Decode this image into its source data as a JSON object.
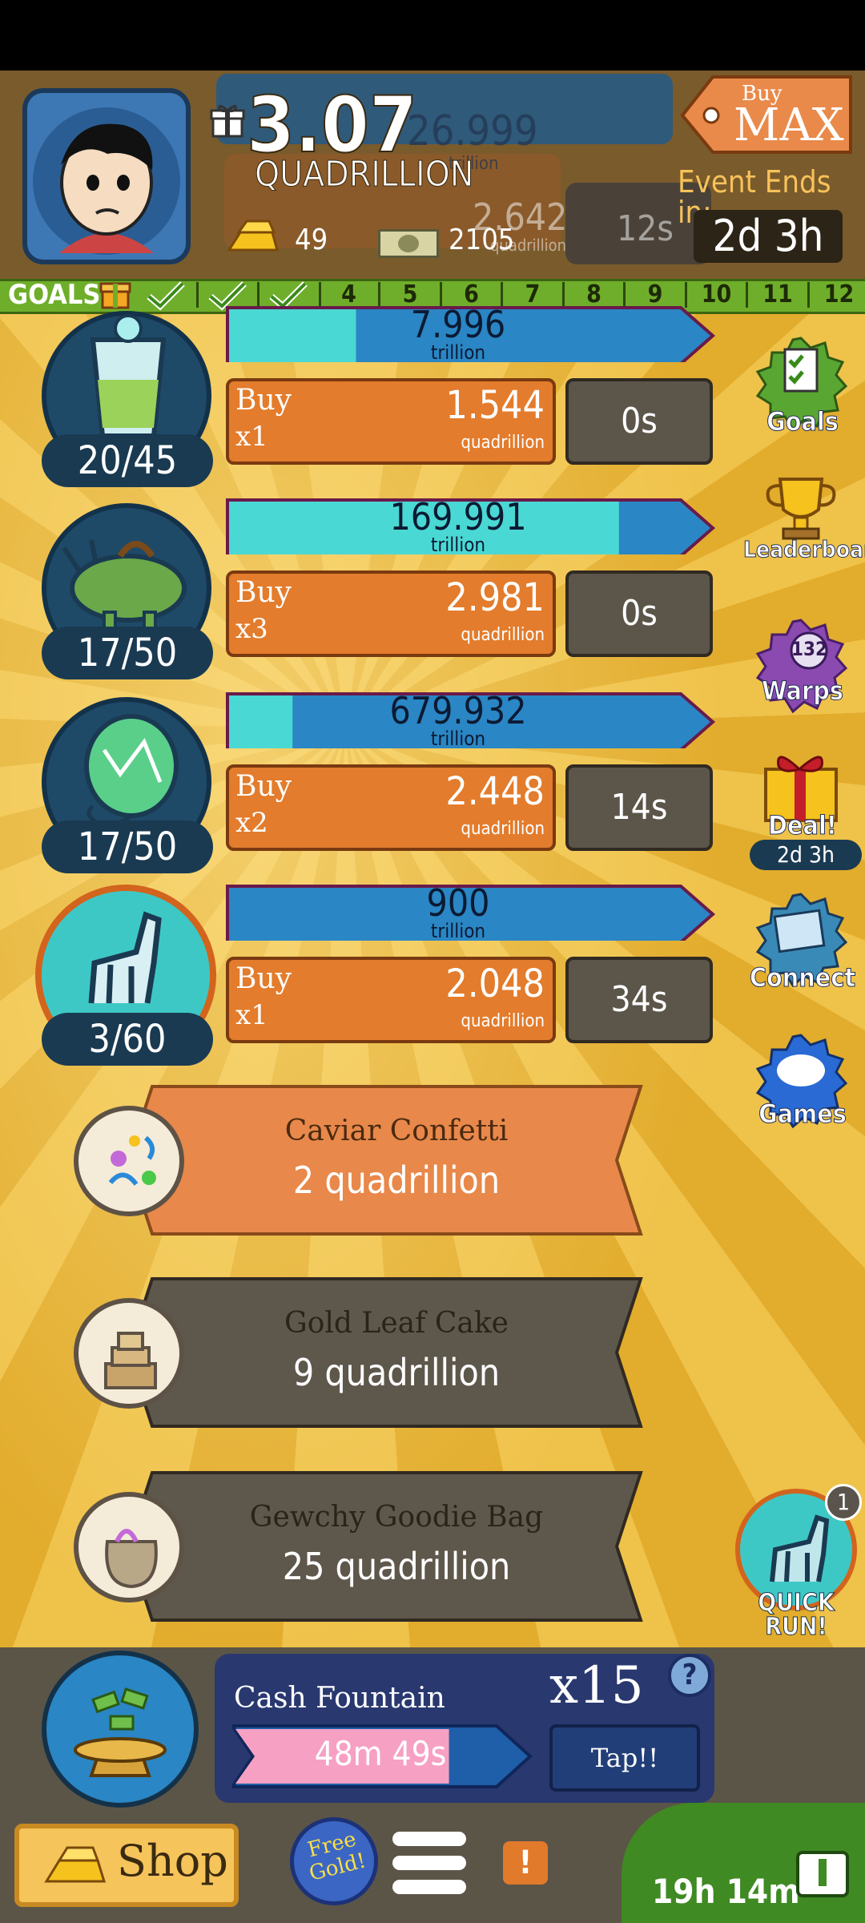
{
  "header": {
    "cash_value": "3.07",
    "cash_unit": "QUADRILLION",
    "gold": "49",
    "megabucks": "2105",
    "buy_max_top": "Buy",
    "buy_max_main": "MAX",
    "event_label": "Event Ends in:",
    "event_time": "2d 3h",
    "behind_values": {
      "top_value": "26.999",
      "top_unit": "trillion",
      "mid_value": "2.642",
      "mid_unit": "quadrillion",
      "timer": "12s"
    }
  },
  "goals": {
    "label": "GOALS",
    "completed": 3,
    "numbers": [
      "4",
      "5",
      "6",
      "7",
      "8",
      "9",
      "10",
      "11",
      "12"
    ]
  },
  "businesses": [
    {
      "name": "lemonade",
      "count": "20/45",
      "revenue": "7.996",
      "revenue_unit": "trillion",
      "progress": 0.28,
      "buy_label": "Buy",
      "multiplier": "x1",
      "price": "1.544",
      "price_unit": "quadrillion",
      "timer": "0s"
    },
    {
      "name": "triceratops",
      "count": "17/50",
      "revenue": "169.991",
      "revenue_unit": "trillion",
      "progress": 0.86,
      "buy_label": "Buy",
      "multiplier": "x3",
      "price": "2.981",
      "price_unit": "quadrillion",
      "timer": "0s"
    },
    {
      "name": "balloon",
      "count": "17/50",
      "revenue": "679.932",
      "revenue_unit": "trillion",
      "progress": 0.14,
      "buy_label": "Buy",
      "multiplier": "x2",
      "price": "2.448",
      "price_unit": "quadrillion",
      "timer": "14s"
    },
    {
      "name": "pinata",
      "count": "3/60",
      "revenue": "900",
      "revenue_unit": "trillion",
      "progress": 0.0,
      "buy_label": "Buy",
      "multiplier": "x1",
      "price": "2.048",
      "price_unit": "quadrillion",
      "timer": "34s"
    }
  ],
  "side_menu": {
    "goals": "Goals",
    "leaderboard": "Leaderboard",
    "warps": "Warps",
    "warps_count": "132",
    "deal": "Deal!",
    "deal_time": "2d 3h",
    "connect": "Connect",
    "games": "Games"
  },
  "upgrades": [
    {
      "title": "Caviar Confetti",
      "price": "2 quadrillion",
      "state": "available"
    },
    {
      "title": "Gold Leaf Cake",
      "price": "9 quadrillion",
      "state": "locked"
    },
    {
      "title": "Gewchy Goodie Bag",
      "price": "25 quadrillion",
      "state": "locked"
    }
  ],
  "quick_run": {
    "label": "QUICK RUN!",
    "badge": "1"
  },
  "cash_fountain": {
    "title": "Cash Fountain",
    "multiplier": "x15",
    "help": "?",
    "timer": "48m 49s",
    "progress": 0.82,
    "tap_label": "Tap!!"
  },
  "bottom": {
    "shop": "Shop",
    "free_gold": "Free Gold!",
    "alert": "!",
    "tv_timer": "19h 14m"
  },
  "colors": {
    "accent_orange": "#e37c2c",
    "bar_blue": "#2a86c4",
    "bar_cyan": "#4ad8d4",
    "goal_green": "#6fae2a",
    "panel_brown": "#5b5548"
  }
}
